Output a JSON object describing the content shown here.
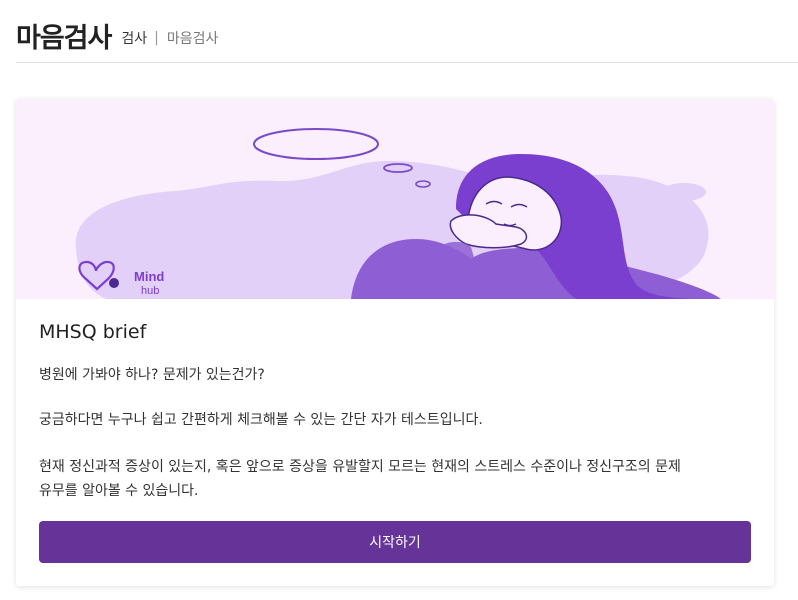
{
  "header": {
    "title": "마음검사",
    "breadcrumb": [
      "검사",
      "마음검사"
    ],
    "separator": "|"
  },
  "card": {
    "banner": {
      "logo_text_line1": "Mind",
      "logo_text_line2": "hub"
    },
    "title": "MHSQ brief",
    "description_1": "병원에 가봐야 하나? 문제가 있는건가?",
    "description_2": "궁금하다면 누구나 쉽고 간편하게 체크해볼 수 있는 간단 자가 테스트입니다.",
    "description_3_line1": "현재 정신과적 증상이 있는지, 혹은 앞으로 증상을 유발할지 모르는 현재의 스트레스 수준이나 정신구조의 문제",
    "description_3_line2": "유무를 알아볼 수 있습니다.",
    "button_label": "시작하기"
  },
  "colors": {
    "accent": "#663399",
    "banner_bg": "#fbeefd",
    "blob": "#e2d0f8",
    "hair": "#7b3fcf",
    "shirt": "#8e5fd4"
  }
}
